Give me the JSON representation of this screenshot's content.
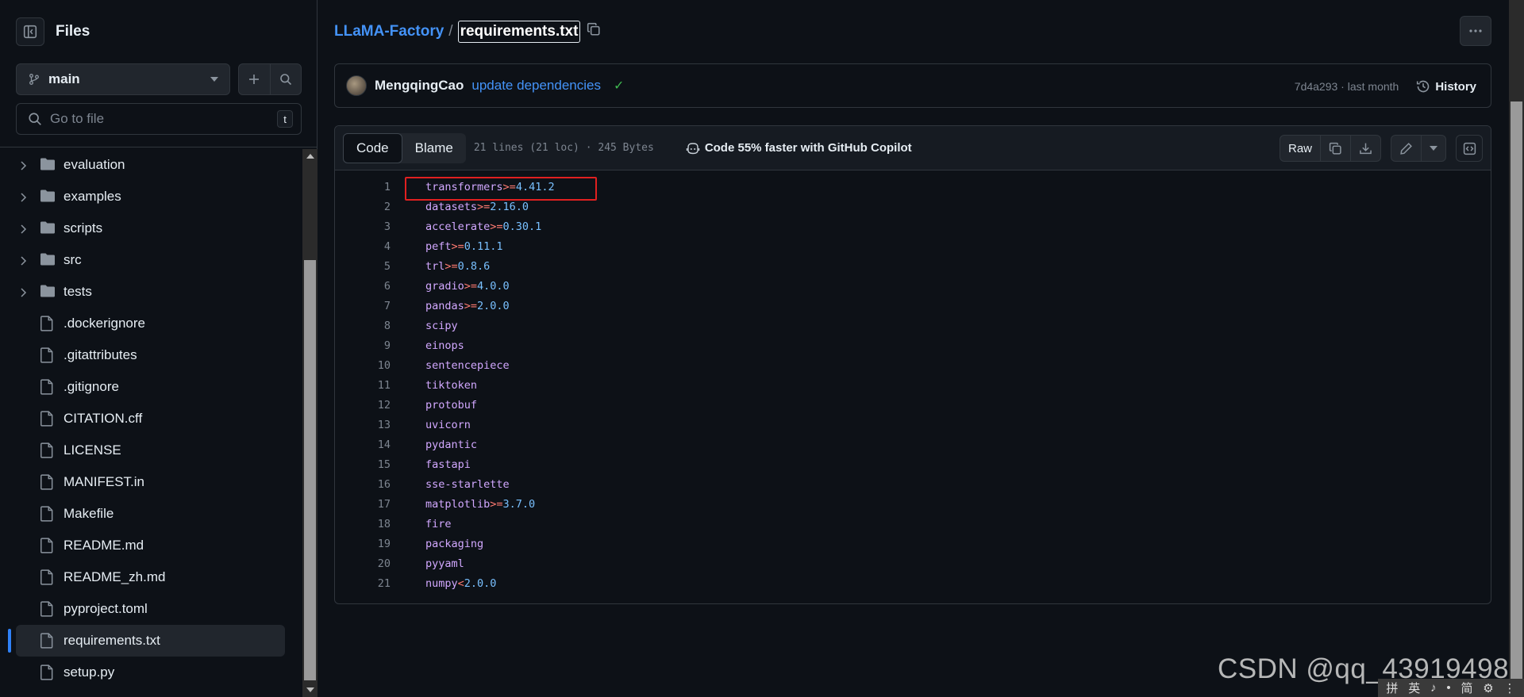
{
  "sidebar": {
    "title": "Files",
    "branch": "main",
    "search_placeholder": "Go to file",
    "search_shortcut": "t",
    "items": [
      {
        "label": "evaluation",
        "type": "folder"
      },
      {
        "label": "examples",
        "type": "folder"
      },
      {
        "label": "scripts",
        "type": "folder"
      },
      {
        "label": "src",
        "type": "folder"
      },
      {
        "label": "tests",
        "type": "folder"
      },
      {
        "label": ".dockerignore",
        "type": "file"
      },
      {
        "label": ".gitattributes",
        "type": "file"
      },
      {
        "label": ".gitignore",
        "type": "file"
      },
      {
        "label": "CITATION.cff",
        "type": "file"
      },
      {
        "label": "LICENSE",
        "type": "file"
      },
      {
        "label": "MANIFEST.in",
        "type": "file"
      },
      {
        "label": "Makefile",
        "type": "file"
      },
      {
        "label": "README.md",
        "type": "file"
      },
      {
        "label": "README_zh.md",
        "type": "file"
      },
      {
        "label": "pyproject.toml",
        "type": "file"
      },
      {
        "label": "requirements.txt",
        "type": "file",
        "selected": true
      },
      {
        "label": "setup.py",
        "type": "file"
      }
    ]
  },
  "breadcrumb": {
    "repo": "LLaMA-Factory",
    "separator": "/",
    "file": "requirements.txt"
  },
  "commit": {
    "author": "MengqingCao",
    "message": "update dependencies",
    "sha_time": "7d4a293 · last month",
    "history_label": "History"
  },
  "code_toolbar": {
    "tab_code": "Code",
    "tab_blame": "Blame",
    "file_info": "21 lines (21 loc) · 245 Bytes",
    "copilot": "Code 55% faster with GitHub Copilot",
    "raw": "Raw"
  },
  "code_lines": [
    {
      "n": "1",
      "pkg": "transformers",
      "op": ">=",
      "ver": "4.41.2"
    },
    {
      "n": "2",
      "pkg": "datasets",
      "op": ">=",
      "ver": "2.16.0"
    },
    {
      "n": "3",
      "pkg": "accelerate",
      "op": ">=",
      "ver": "0.30.1"
    },
    {
      "n": "4",
      "pkg": "peft",
      "op": ">=",
      "ver": "0.11.1"
    },
    {
      "n": "5",
      "pkg": "trl",
      "op": ">=",
      "ver": "0.8.6"
    },
    {
      "n": "6",
      "pkg": "gradio",
      "op": ">=",
      "ver": "4.0.0"
    },
    {
      "n": "7",
      "pkg": "pandas",
      "op": ">=",
      "ver": "2.0.0"
    },
    {
      "n": "8",
      "pkg": "scipy",
      "op": "",
      "ver": ""
    },
    {
      "n": "9",
      "pkg": "einops",
      "op": "",
      "ver": ""
    },
    {
      "n": "10",
      "pkg": "sentencepiece",
      "op": "",
      "ver": ""
    },
    {
      "n": "11",
      "pkg": "tiktoken",
      "op": "",
      "ver": ""
    },
    {
      "n": "12",
      "pkg": "protobuf",
      "op": "",
      "ver": ""
    },
    {
      "n": "13",
      "pkg": "uvicorn",
      "op": "",
      "ver": ""
    },
    {
      "n": "14",
      "pkg": "pydantic",
      "op": "",
      "ver": ""
    },
    {
      "n": "15",
      "pkg": "fastapi",
      "op": "",
      "ver": ""
    },
    {
      "n": "16",
      "pkg": "sse-starlette",
      "op": "",
      "ver": ""
    },
    {
      "n": "17",
      "pkg": "matplotlib",
      "op": ">=",
      "ver": "3.7.0"
    },
    {
      "n": "18",
      "pkg": "fire",
      "op": "",
      "ver": ""
    },
    {
      "n": "19",
      "pkg": "packaging",
      "op": "",
      "ver": ""
    },
    {
      "n": "20",
      "pkg": "pyyaml",
      "op": "",
      "ver": ""
    },
    {
      "n": "21",
      "pkg": "numpy",
      "op": "<",
      "ver": "2.0.0"
    }
  ],
  "watermark": "CSDN @qq_43919498",
  "ime_bar": [
    "拼",
    "英",
    "♪",
    "•",
    "简",
    "⚙",
    "⋮"
  ],
  "colors": {
    "accent": "#4493f8",
    "background": "#0d1117",
    "highlight_box": "#e02020",
    "success": "#3fb950"
  }
}
